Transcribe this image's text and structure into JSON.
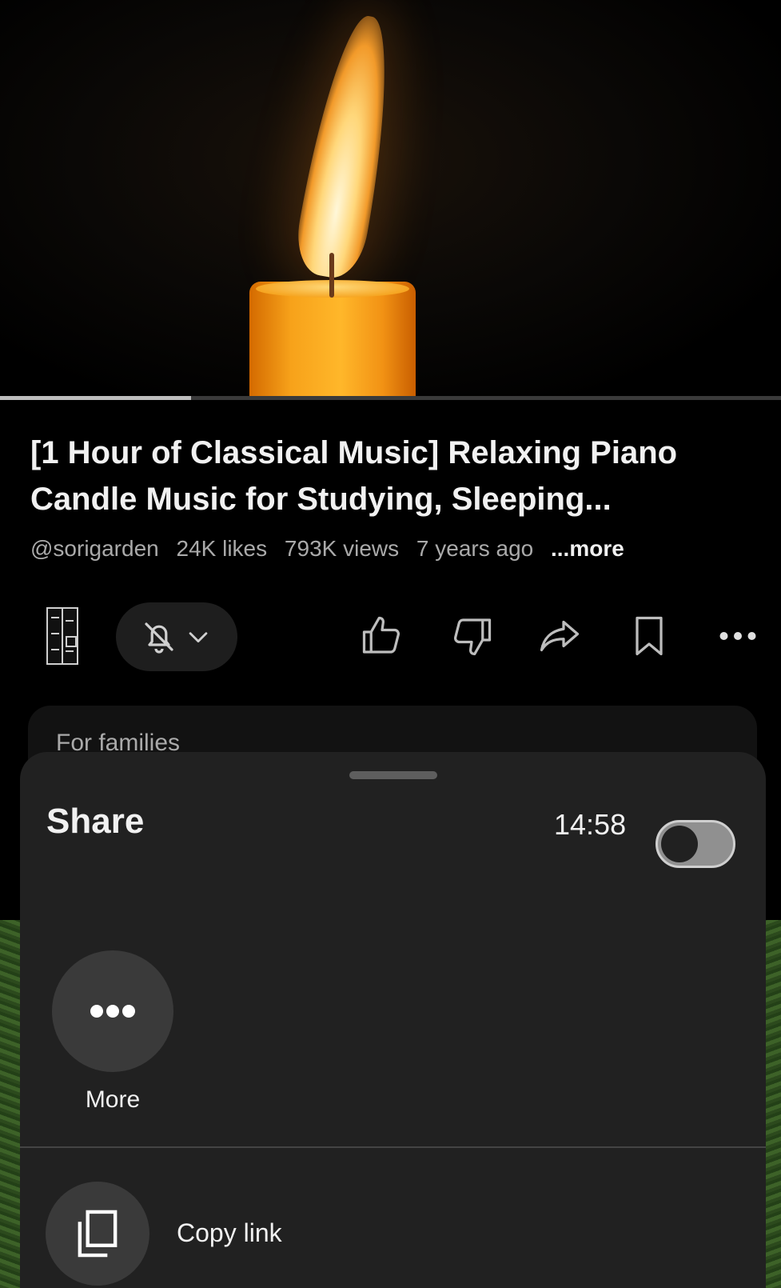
{
  "video": {
    "progress_fraction": 0.245
  },
  "details": {
    "title": "[1 Hour of Classical Music] Relaxing Piano Candle Music for Studying, Sleeping...",
    "channel_handle": "@sorigarden",
    "likes": "24K likes",
    "views": "793K views",
    "age": "7 years ago",
    "more_link": "...more"
  },
  "actions": {
    "channel_icon": "channel-avatar-icon",
    "subscribe_bell_icon": "bell-off-icon",
    "chevron_icon": "chevron-down-icon",
    "like_icon": "thumbs-up-icon",
    "dislike_icon": "thumbs-down-icon",
    "share_icon": "share-arrow-icon",
    "save_icon": "bookmark-icon",
    "overflow_icon": "more-horizontal-icon"
  },
  "families_card": {
    "label": "For families"
  },
  "share_sheet": {
    "title": "Share",
    "start_time": "14:58",
    "start_at_toggle_on": false,
    "more_label": "More",
    "copy_link_label": "Copy link"
  },
  "colors": {
    "background": "#000000",
    "sheet": "#212121",
    "text": "#f1f1f1",
    "secondary_text": "#aaaaaa"
  }
}
